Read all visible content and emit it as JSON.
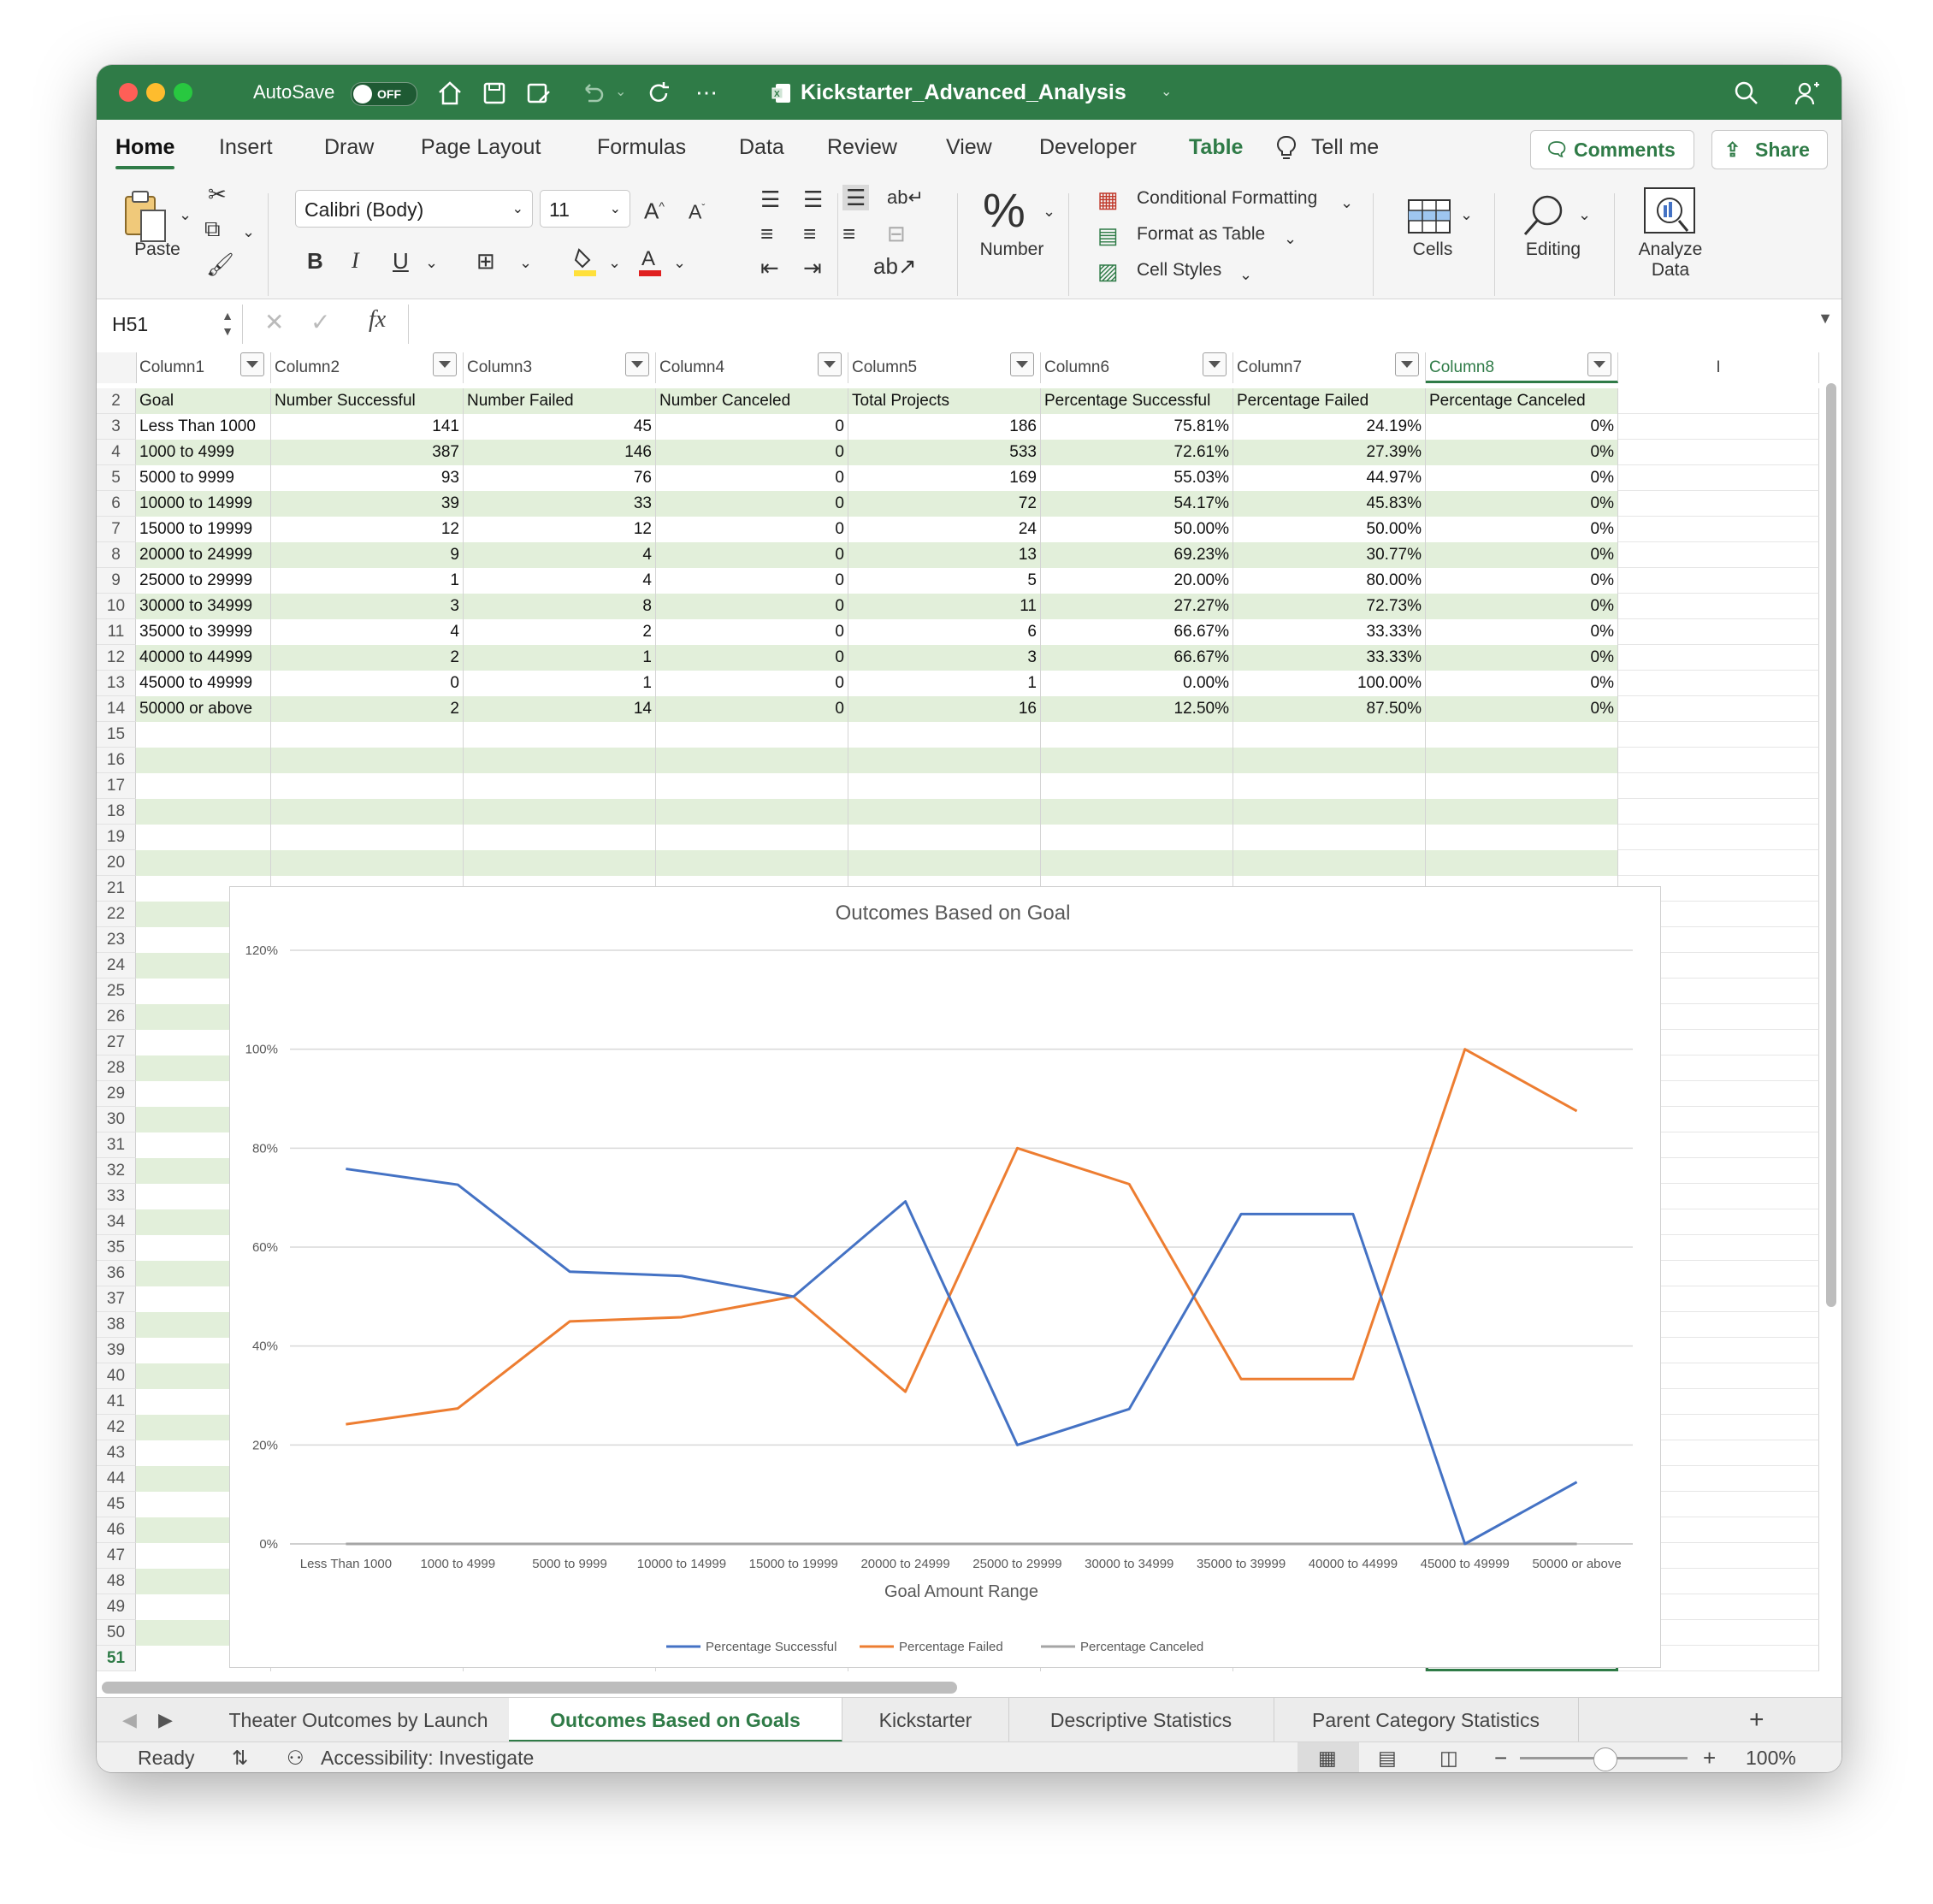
{
  "window": {
    "autosave_label": "AutoSave",
    "autosave_state": "OFF",
    "file_title": "Kickstarter_Advanced_Analysis"
  },
  "ribbon_tabs": [
    "Home",
    "Insert",
    "Draw",
    "Page Layout",
    "Formulas",
    "Data",
    "Review",
    "View",
    "Developer",
    "Table",
    "Tell me"
  ],
  "ribbon_buttons": {
    "comments": "Comments",
    "share": "Share"
  },
  "ribbon": {
    "paste": "Paste",
    "font_name": "Calibri (Body)",
    "font_size": "11",
    "bold": "B",
    "italic": "I",
    "underline": "U",
    "number": "Number",
    "conditional_formatting": "Conditional Formatting",
    "format_as_table": "Format as Table",
    "cell_styles": "Cell Styles",
    "cells": "Cells",
    "editing": "Editing",
    "analyze_data_1": "Analyze",
    "analyze_data_2": "Data"
  },
  "formula_bar": {
    "name_box": "H51",
    "fx": "fx",
    "formula": ""
  },
  "columns": [
    "Column1",
    "Column2",
    "Column3",
    "Column4",
    "Column5",
    "Column6",
    "Column7",
    "Column8"
  ],
  "col_letter_i": "I",
  "header_row": [
    "Goal",
    "Number Successful",
    "Number Failed",
    "Number Canceled",
    "Total Projects",
    "Percentage Successful",
    "Percentage Failed",
    "Percentage Canceled"
  ],
  "data_rows": [
    [
      "Less Than 1000",
      "141",
      "45",
      "0",
      "186",
      "75.81%",
      "24.19%",
      "0%"
    ],
    [
      "1000 to 4999",
      "387",
      "146",
      "0",
      "533",
      "72.61%",
      "27.39%",
      "0%"
    ],
    [
      "5000 to 9999",
      "93",
      "76",
      "0",
      "169",
      "55.03%",
      "44.97%",
      "0%"
    ],
    [
      "10000 to 14999",
      "39",
      "33",
      "0",
      "72",
      "54.17%",
      "45.83%",
      "0%"
    ],
    [
      "15000 to 19999",
      "12",
      "12",
      "0",
      "24",
      "50.00%",
      "50.00%",
      "0%"
    ],
    [
      "20000 to 24999",
      "9",
      "4",
      "0",
      "13",
      "69.23%",
      "30.77%",
      "0%"
    ],
    [
      "25000 to 29999",
      "1",
      "4",
      "0",
      "5",
      "20.00%",
      "80.00%",
      "0%"
    ],
    [
      "30000 to 34999",
      "3",
      "8",
      "0",
      "11",
      "27.27%",
      "72.73%",
      "0%"
    ],
    [
      "35000 to 39999",
      "4",
      "2",
      "0",
      "6",
      "66.67%",
      "33.33%",
      "0%"
    ],
    [
      "40000 to 44999",
      "2",
      "1",
      "0",
      "3",
      "66.67%",
      "33.33%",
      "0%"
    ],
    [
      "45000 to 49999",
      "0",
      "1",
      "0",
      "1",
      "0.00%",
      "100.00%",
      "0%"
    ],
    [
      "50000 or above",
      "2",
      "14",
      "0",
      "16",
      "12.50%",
      "87.50%",
      "0%"
    ]
  ],
  "row_numbers": [
    "2",
    "3",
    "4",
    "5",
    "6",
    "7",
    "8",
    "9",
    "10",
    "11",
    "12",
    "13",
    "14",
    "15",
    "16",
    "17",
    "18",
    "19",
    "20",
    "21",
    "22",
    "23",
    "24",
    "25",
    "26",
    "27",
    "28",
    "29",
    "30",
    "31",
    "32",
    "33",
    "34",
    "35",
    "36",
    "37",
    "38",
    "39",
    "40",
    "41",
    "42",
    "43",
    "44",
    "45",
    "46",
    "47",
    "48",
    "49",
    "50",
    "51"
  ],
  "chart_data": {
    "type": "line",
    "title": "Outcomes Based on Goal",
    "xlabel": "Goal Amount Range",
    "ylabel": "",
    "ylim": [
      0,
      1.2
    ],
    "y_ticks": [
      "0%",
      "20%",
      "40%",
      "60%",
      "80%",
      "100%",
      "120%"
    ],
    "categories": [
      "Less Than 1000",
      "1000 to 4999",
      "5000 to 9999",
      "10000 to 14999",
      "15000 to 19999",
      "20000 to 24999",
      "25000 to 29999",
      "30000 to 34999",
      "35000 to 39999",
      "40000 to 44999",
      "45000 to 49999",
      "50000 or above"
    ],
    "series": [
      {
        "name": "Percentage Successful",
        "color": "#4472c4",
        "values": [
          0.7581,
          0.7261,
          0.5503,
          0.5417,
          0.5,
          0.6923,
          0.2,
          0.2727,
          0.6667,
          0.6667,
          0.0,
          0.125
        ]
      },
      {
        "name": "Percentage Failed",
        "color": "#ed7d31",
        "values": [
          0.2419,
          0.2739,
          0.4497,
          0.4583,
          0.5,
          0.3077,
          0.8,
          0.7273,
          0.3333,
          0.3333,
          1.0,
          0.875
        ]
      },
      {
        "name": "Percentage Canceled",
        "color": "#a5a5a5",
        "values": [
          0,
          0,
          0,
          0,
          0,
          0,
          0,
          0,
          0,
          0,
          0,
          0
        ]
      }
    ],
    "grid": true,
    "legend": "bottom"
  },
  "sheet_tabs": [
    "Theater Outcomes by Launch Date",
    "Outcomes Based on Goals",
    "Kickstarter",
    "Descriptive Statistics",
    "Parent Category Statistics"
  ],
  "active_sheet": "Outcomes Based on Goals",
  "add_sheet": "+",
  "status": {
    "ready": "Ready",
    "accessibility": "Accessibility: Investigate",
    "zoom": "100%",
    "zoom_minus": "−",
    "zoom_plus": "+"
  },
  "colors": {
    "accent": "#2f7b47",
    "band": "#e2efda"
  }
}
